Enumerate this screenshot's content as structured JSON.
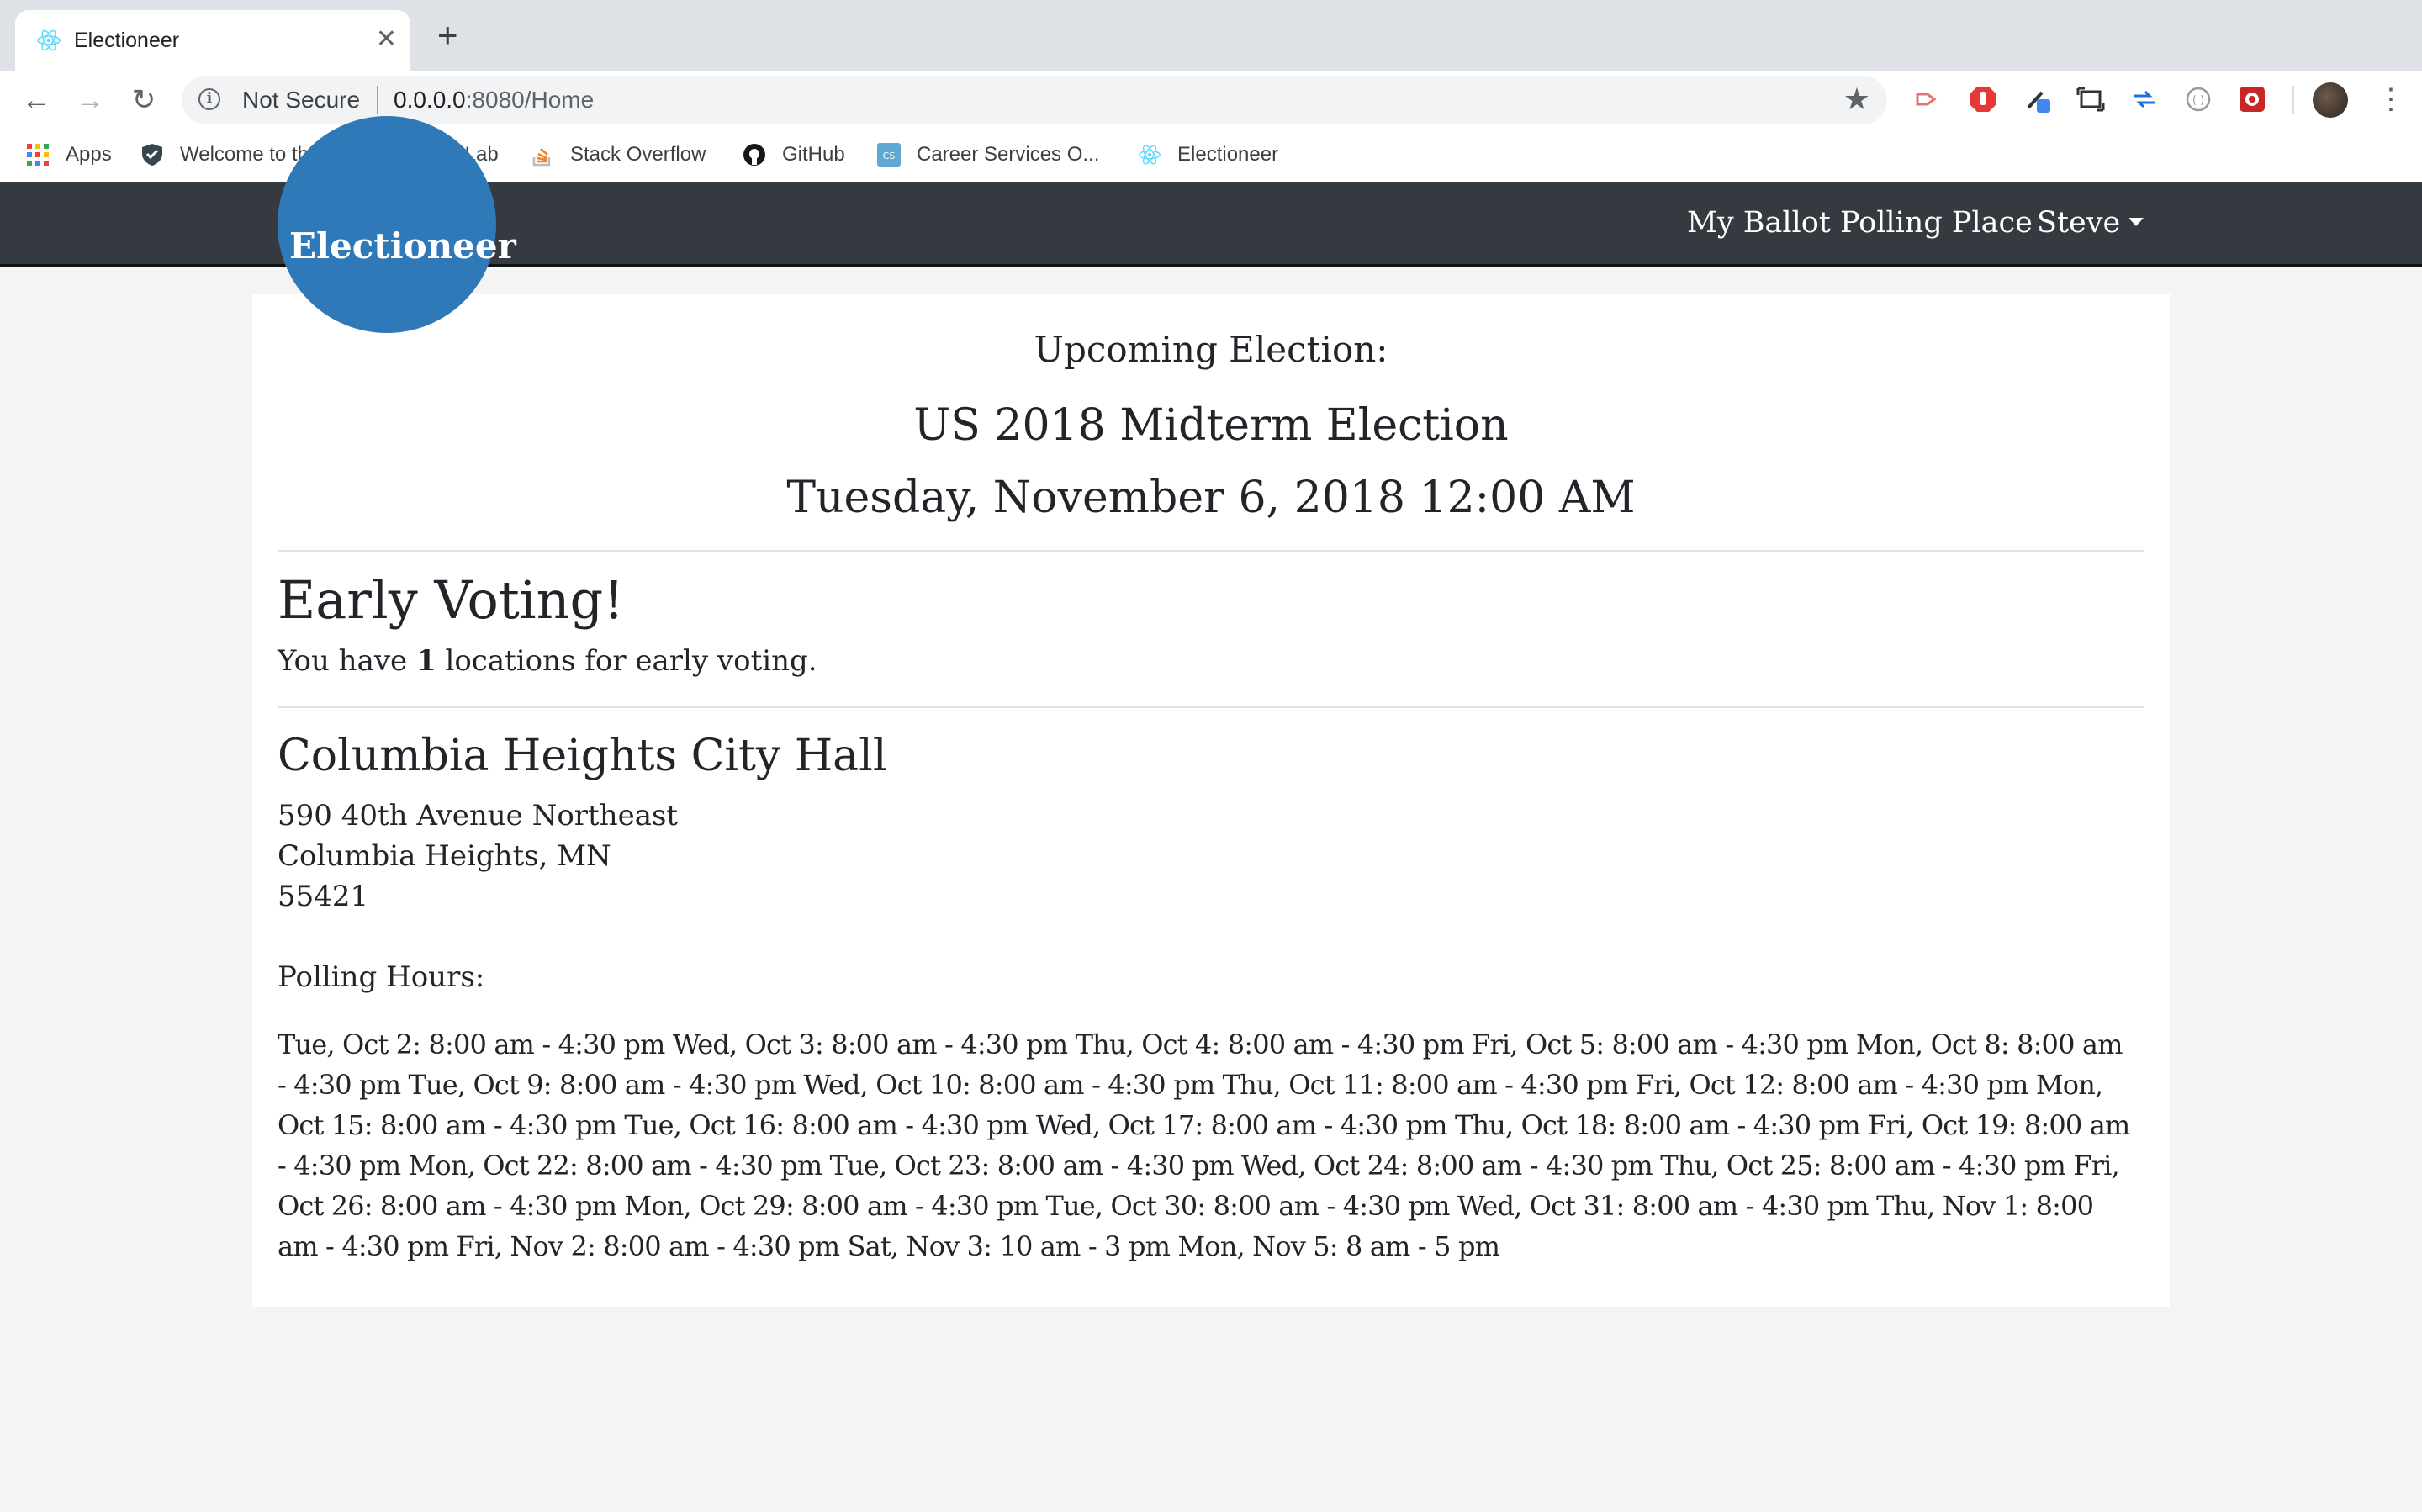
{
  "browser": {
    "tab_title": "Electioneer",
    "security_label": "Not Secure",
    "url_host": "0.0.0.0",
    "url_rest": ":8080/Home",
    "bookmarks": [
      {
        "label": "Apps",
        "icon": "apps-grid-icon"
      },
      {
        "label": "Welcome to the N...",
        "icon": "shield-check-icon"
      },
      {
        "label": "GitLab",
        "icon": "gitlab-icon"
      },
      {
        "label": "Stack Overflow",
        "icon": "stackoverflow-icon"
      },
      {
        "label": "GitHub",
        "icon": "github-icon"
      },
      {
        "label": "Career Services O...",
        "icon": "cs-icon"
      },
      {
        "label": "Electioneer",
        "icon": "react-icon"
      }
    ]
  },
  "app": {
    "brand": "Electioneer",
    "nav": {
      "my_ballot": "My Ballot",
      "polling_place": "Polling Place",
      "user": "Steve"
    },
    "colors": {
      "navbar": "#343a40",
      "brand": "#2f79b8"
    }
  },
  "election": {
    "heading": "Upcoming Election:",
    "name": "US 2018 Midterm Election",
    "date": "Tuesday, November 6, 2018 12:00 AM"
  },
  "early_voting": {
    "title": "Early Voting!",
    "count_prefix": "You have ",
    "count": "1",
    "count_suffix": " locations for early voting."
  },
  "location": {
    "name": "Columbia Heights City Hall",
    "address_line1": "590 40th Avenue Northeast",
    "address_line2": "Columbia Heights, MN",
    "zip": "55421",
    "hours_label": "Polling Hours:",
    "hours_lines": [
      "Tue, Oct 2: 8:00 am - 4:30 pm Wed, Oct 3: 8:00 am - 4:30 pm Thu, Oct 4: 8:00 am - 4:30 pm Fri, Oct 5: 8:00 am - 4:30 pm Mon, Oct 8: 8:00 am",
      "- 4:30 pm Tue, Oct 9: 8:00 am - 4:30 pm Wed, Oct 10: 8:00 am - 4:30 pm Thu, Oct 11: 8:00 am - 4:30 pm Fri, Oct 12: 8:00 am - 4:30 pm Mon,",
      "Oct 15: 8:00 am - 4:30 pm Tue, Oct 16: 8:00 am - 4:30 pm Wed, Oct 17: 8:00 am - 4:30 pm Thu, Oct 18: 8:00 am - 4:30 pm Fri, Oct 19: 8:00 am",
      "- 4:30 pm Mon, Oct 22: 8:00 am - 4:30 pm Tue, Oct 23: 8:00 am - 4:30 pm Wed, Oct 24: 8:00 am - 4:30 pm Thu, Oct 25: 8:00 am - 4:30 pm Fri,",
      "Oct 26: 8:00 am - 4:30 pm Mon, Oct 29: 8:00 am - 4:30 pm Tue, Oct 30: 8:00 am - 4:30 pm Wed, Oct 31: 8:00 am - 4:30 pm Thu, Nov 1: 8:00",
      "am - 4:30 pm Fri, Nov 2: 8:00 am - 4:30 pm Sat, Nov 3: 10 am - 3 pm Mon, Nov 5: 8 am - 5 pm"
    ]
  }
}
